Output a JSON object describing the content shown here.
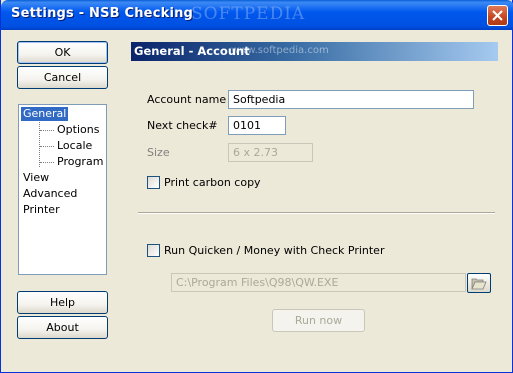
{
  "window": {
    "title": "Settings - NSB Checking",
    "watermark": "SOFTPEDIA"
  },
  "buttons": {
    "ok": "OK",
    "cancel": "Cancel",
    "help": "Help",
    "about": "About",
    "run_now": "Run now"
  },
  "tree": {
    "items": [
      {
        "label": "General",
        "selected": true
      },
      {
        "label": "Options"
      },
      {
        "label": "Locale"
      },
      {
        "label": "Program"
      },
      {
        "label": "View"
      },
      {
        "label": "Advanced"
      },
      {
        "label": "Printer"
      }
    ]
  },
  "panel": {
    "header": "General - Account",
    "header_watermark": "www.softpedia.com",
    "account_name_label": "Account name",
    "account_name_value": "Softpedia",
    "next_check_label": "Next check#",
    "next_check_value": "0101",
    "size_label": "Size",
    "size_value": "6 x 2.73",
    "print_carbon_copy_label": "Print carbon copy",
    "print_carbon_copy_checked": false,
    "run_quicken_label": "Run Quicken / Money with Check Printer",
    "run_quicken_checked": false,
    "program_path_value": "C:\\Program Files\\Q98\\QW.EXE"
  },
  "icons": {
    "close": "close-icon",
    "browse": "folder-open-icon"
  },
  "colors": {
    "titlebar": "#0058ee",
    "selection": "#316ac5",
    "dialog_bg": "#ece9d8"
  }
}
